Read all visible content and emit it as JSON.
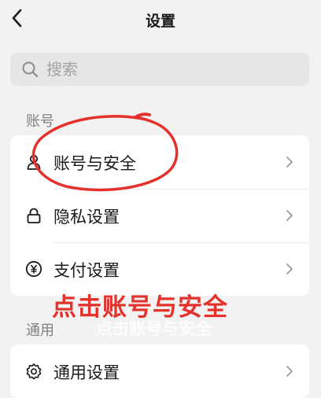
{
  "header": {
    "title": "设置",
    "back_icon": "chevron-left-icon"
  },
  "search": {
    "placeholder": "搜索",
    "icon": "search-icon"
  },
  "sections": [
    {
      "label": "账号",
      "items": [
        {
          "label": "账号与安全",
          "icon": "person-icon"
        },
        {
          "label": "隐私设置",
          "icon": "lock-icon"
        },
        {
          "label": "支付设置",
          "icon": "yen-icon"
        }
      ]
    },
    {
      "label": "通用",
      "items": [
        {
          "label": "通用设置",
          "icon": "gear-icon"
        }
      ]
    }
  ],
  "annotation": {
    "text": "点击账号与安全",
    "watermark": "点击账号与安全",
    "color": "#e5312c"
  }
}
